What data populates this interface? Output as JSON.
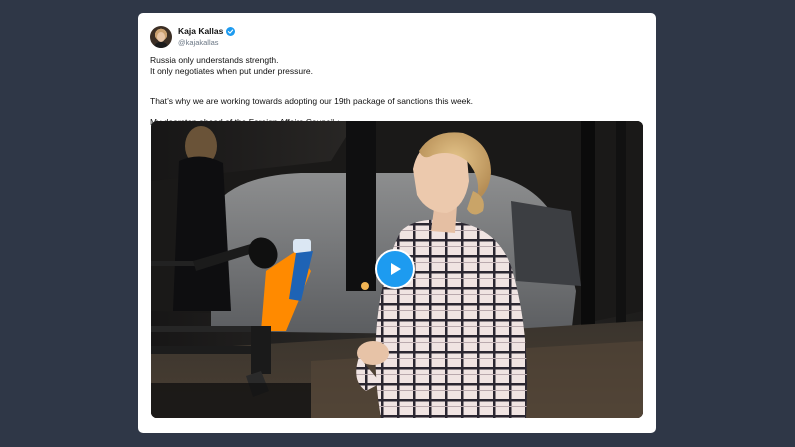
{
  "tweet": {
    "author_name": "Kaja Kallas",
    "author_handle": "@kajakallas",
    "verified": true,
    "line_1": "Russia only understands strength.",
    "line_2": "It only negotiates when put under pressure.",
    "line_3": "That’s why we are working towards adopting our 19th package of sanctions this week.",
    "line_4": "My doorstep ahead of the Foreign Affairs Council ↓"
  },
  "media": {
    "type": "video",
    "play_icon": "play-icon",
    "microphone_logos": [
      "ARD",
      "NOS"
    ]
  },
  "colors": {
    "page_background": "#2f3747",
    "card_background": "#ffffff",
    "accent_blue": "#1d9bf0",
    "handle_gray": "#6b7785"
  }
}
